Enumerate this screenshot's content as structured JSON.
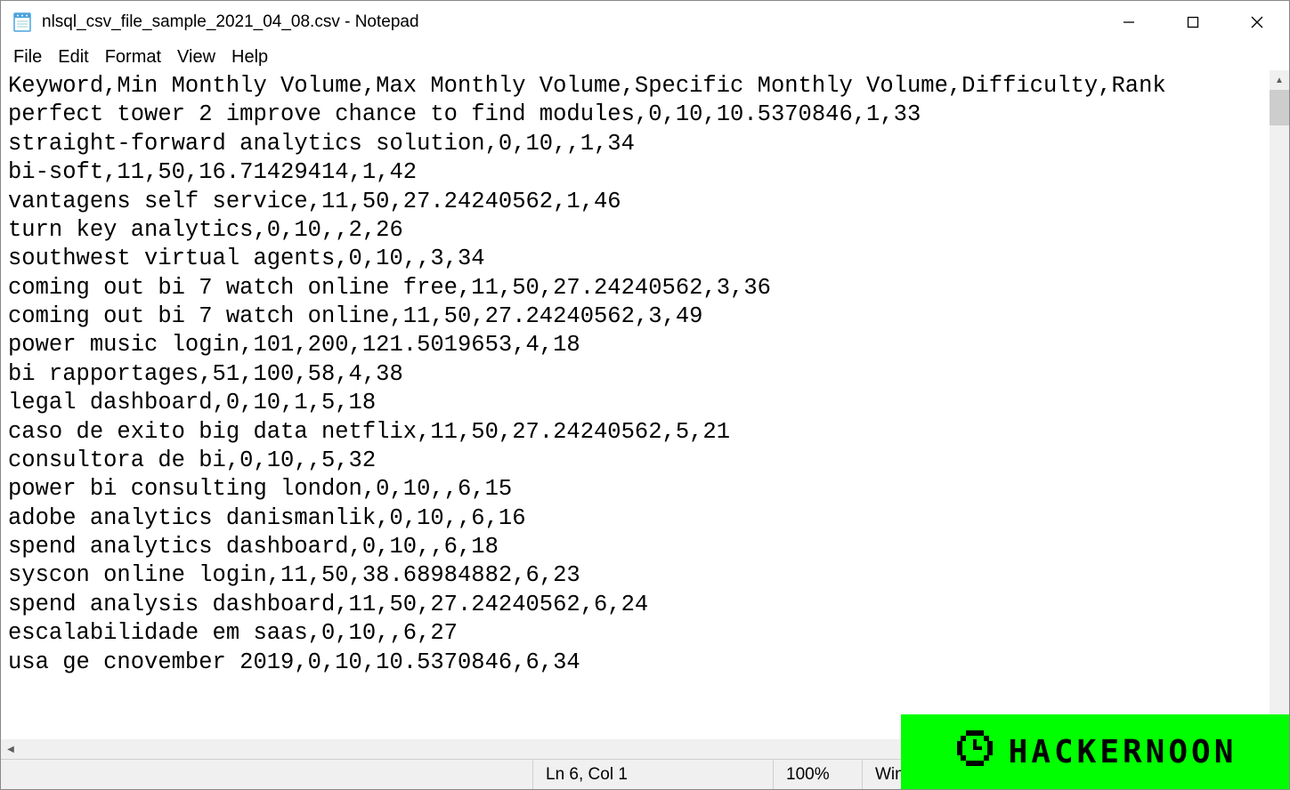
{
  "window": {
    "title": "nlsql_csv_file_sample_2021_04_08.csv - Notepad"
  },
  "menu": {
    "file": "File",
    "edit": "Edit",
    "format": "Format",
    "view": "View",
    "help": "Help"
  },
  "content_lines": [
    "Keyword,Min Monthly Volume,Max Monthly Volume,Specific Monthly Volume,Difficulty,Rank",
    "perfect tower 2 improve chance to find modules,0,10,10.5370846,1,33",
    "straight-forward analytics solution,0,10,,1,34",
    "bi-soft,11,50,16.71429414,1,42",
    "vantagens self service,11,50,27.24240562,1,46",
    "turn key analytics,0,10,,2,26",
    "southwest virtual agents,0,10,,3,34",
    "coming out bi 7 watch online free,11,50,27.24240562,3,36",
    "coming out bi 7 watch online,11,50,27.24240562,3,49",
    "power music login,101,200,121.5019653,4,18",
    "bi rapportages,51,100,58,4,38",
    "legal dashboard,0,10,1,5,18",
    "caso de exito big data netflix,11,50,27.24240562,5,21",
    "consultora de bi,0,10,,5,32",
    "power bi consulting london,0,10,,6,15",
    "adobe analytics danismanlik,0,10,,6,16",
    "spend analytics dashboard,0,10,,6,18",
    "syscon online login,11,50,38.68984882,6,23",
    "spend analysis dashboard,11,50,27.24240562,6,24",
    "escalabilidade em saas,0,10,,6,27",
    "usa ge cnovember 2019,0,10,10.5370846,6,34"
  ],
  "status": {
    "position": "Ln 6, Col 1",
    "zoom": "100%",
    "line_ending": "Windo"
  },
  "watermark": {
    "text": "HACKERNOON"
  }
}
